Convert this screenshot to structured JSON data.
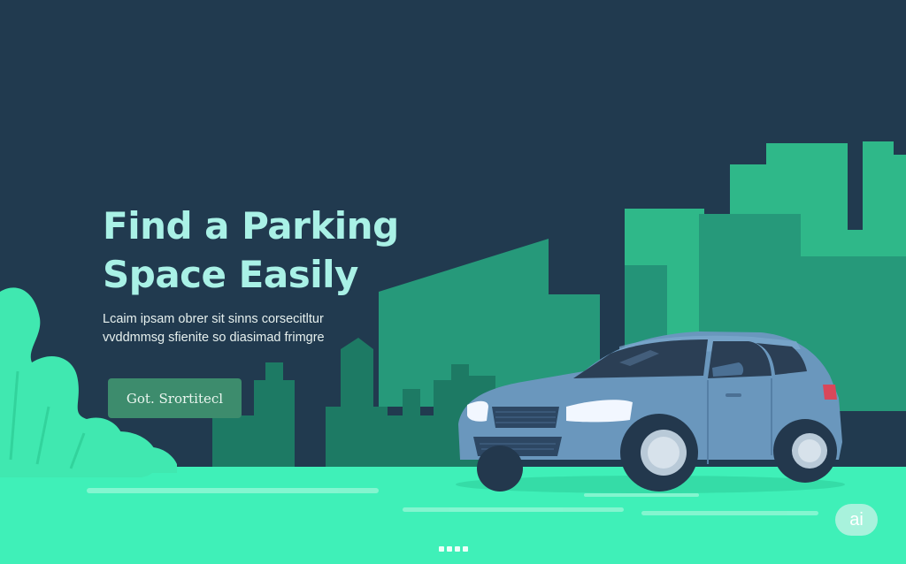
{
  "hero": {
    "title_line1": "Find a Parking",
    "title_line2": "Space Easily",
    "body_line1": "Lcaim ipsam obrer sit sinns corsecitltur",
    "body_line2": "vvddmmsg sfienite so diasimad frimgre",
    "cta_label": "Got. Srortitecl"
  },
  "badge": {
    "label": "ai"
  },
  "colors": {
    "sky": "#213a4f",
    "buildings": "#2a9d7a",
    "ground": "#3ff0b8",
    "car_body": "#6a97bd",
    "title": "#a9f1e6",
    "cta": "#3d8c6d"
  },
  "icons": [
    "car-illustration",
    "city-skyline",
    "bush-illustration",
    "ai-badge-icon"
  ]
}
